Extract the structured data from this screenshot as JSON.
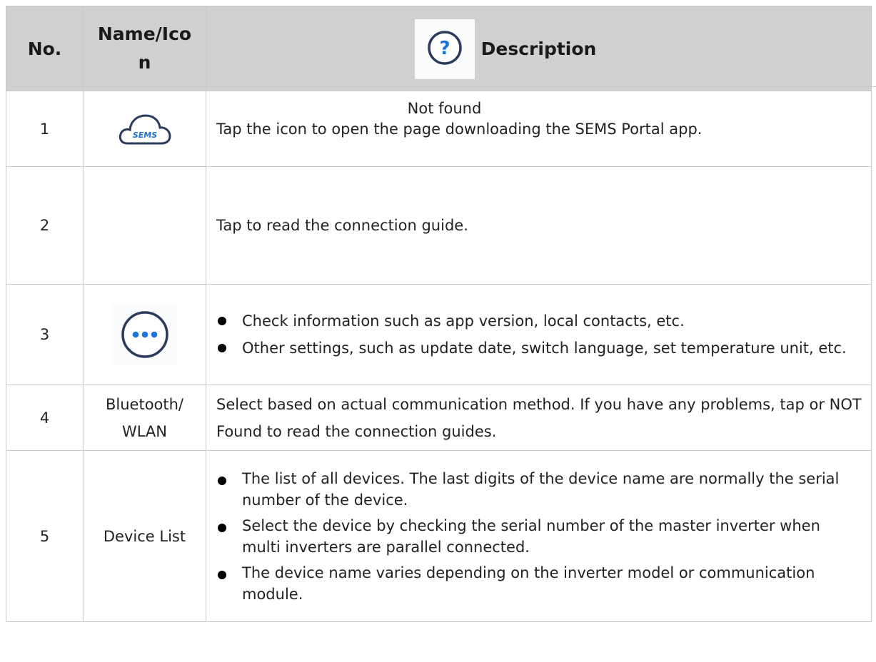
{
  "header": {
    "no": "No.",
    "name": "Name/Ico\nn",
    "description": "Description"
  },
  "rows": [
    {
      "no": "1",
      "icon": "sems-cloud-icon",
      "icon_text": "SEMS",
      "description": "Tap the icon to open the page downloading the SEMS Portal app."
    },
    {
      "no": "2",
      "icon": "question-icon",
      "name_text": "Not found",
      "description": "Tap to read the connection guide."
    },
    {
      "no": "3",
      "icon": "more-icon",
      "bullets": [
        "Check information such as app version, local contacts, etc.",
        "Other settings, such as update date, switch language, set temperature unit, etc."
      ]
    },
    {
      "no": "4",
      "name": "Bluetooth/ WLAN",
      "description": "Select based on actual communication method. If you have any problems, tap  or NOT Found to read the connection guides."
    },
    {
      "no": "5",
      "name": "Device List",
      "bullets": [
        "The list of all devices. The last digits of the device name are normally the serial number of the device.",
        "Select the device by checking the serial number of the master inverter when multi inverters are parallel connected.",
        "The device name varies depending on the inverter model or communication module."
      ]
    }
  ],
  "colors": {
    "header_bg": "#d0d0d0",
    "border": "#c9c9c9",
    "icon_blue": "#1a73d9",
    "icon_navy": "#2a3b5c"
  }
}
